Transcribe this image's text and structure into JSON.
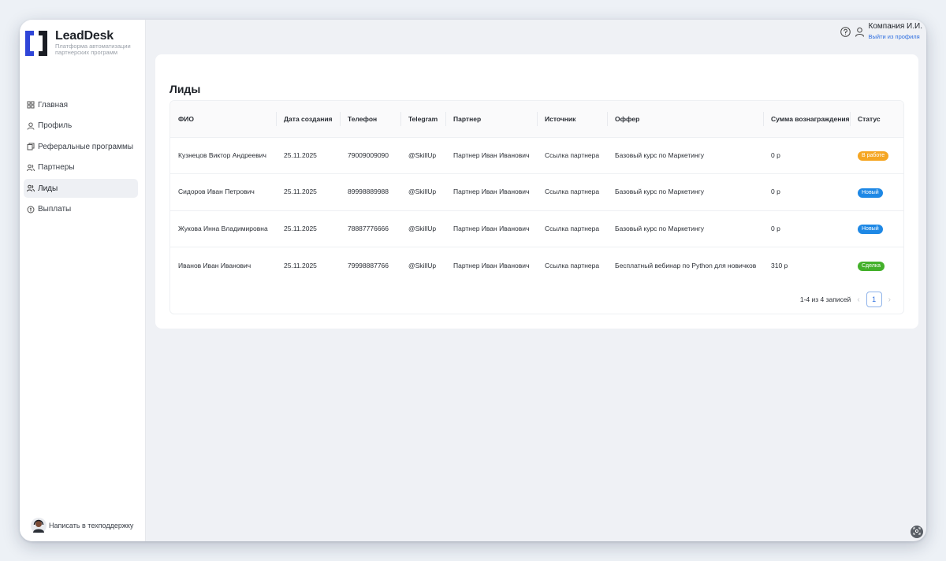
{
  "brand": {
    "name": "LeadDesk",
    "subtitle": "Платформа автоматизации партнерских программ",
    "colors": {
      "primary": "#2f45d8",
      "dark": "#1a1d24"
    }
  },
  "sidebar": {
    "items": [
      {
        "label": "Главная",
        "icon": "grid-icon",
        "active": false
      },
      {
        "label": "Профиль",
        "icon": "user-icon",
        "active": false
      },
      {
        "label": "Реферальные программы",
        "icon": "copy-icon",
        "active": false
      },
      {
        "label": "Партнеры",
        "icon": "users-icon",
        "active": false
      },
      {
        "label": "Лиды",
        "icon": "users-icon",
        "active": true
      },
      {
        "label": "Выплаты",
        "icon": "coin-icon",
        "active": false
      }
    ],
    "support": "Написать в техподдержку"
  },
  "topbar": {
    "company": "Компания И.И.",
    "logout": "Выйти из профиля"
  },
  "main": {
    "title": "Лиды",
    "columns": [
      "ФИО",
      "Дата создания",
      "Телефон",
      "Telegram",
      "Партнер",
      "Источник",
      "Оффер",
      "Сумма вознаграждения",
      "Статус"
    ],
    "rows": [
      {
        "name": "Кузнецов Виктор Андреевич",
        "date": "25.11.2025",
        "phone": "79009009090",
        "telegram": "@SkillUp",
        "partner": "Партнер Иван Иванович",
        "source": "Ссылка партнера",
        "offer": "Базовый курс по Маркетингу",
        "amount": "0 р",
        "status": "В работе",
        "status_color": "#f5a623"
      },
      {
        "name": "Сидоров Иван Петрович",
        "date": "25.11.2025",
        "phone": "89998889988",
        "telegram": "@SkillUp",
        "partner": "Партнер Иван Иванович",
        "source": "Ссылка партнера",
        "offer": "Базовый курс по Маркетингу",
        "amount": "0 р",
        "status": "Новый",
        "status_color": "#1e88e5"
      },
      {
        "name": "Жукова Инна Владимировна",
        "date": "25.11.2025",
        "phone": "78887776666",
        "telegram": "@SkillUp",
        "partner": "Партнер Иван Иванович",
        "source": "Ссылка партнера",
        "offer": "Базовый курс по Маркетингу",
        "amount": "0 р",
        "status": "Новый",
        "status_color": "#1e88e5"
      },
      {
        "name": "Иванов Иван Иванович",
        "date": "25.11.2025",
        "phone": "79998887766",
        "telegram": "@SkillUp",
        "partner": "Партнер Иван Иванович",
        "source": "Ссылка партнера",
        "offer": "Бесплатный вебинар по Python для новичков",
        "amount": "310 р",
        "status": "Сделка",
        "status_color": "#43b02a"
      }
    ],
    "pagination": {
      "summary": "1-4 из 4 записей",
      "current_page": "1",
      "prev": "‹",
      "next": "›"
    }
  }
}
